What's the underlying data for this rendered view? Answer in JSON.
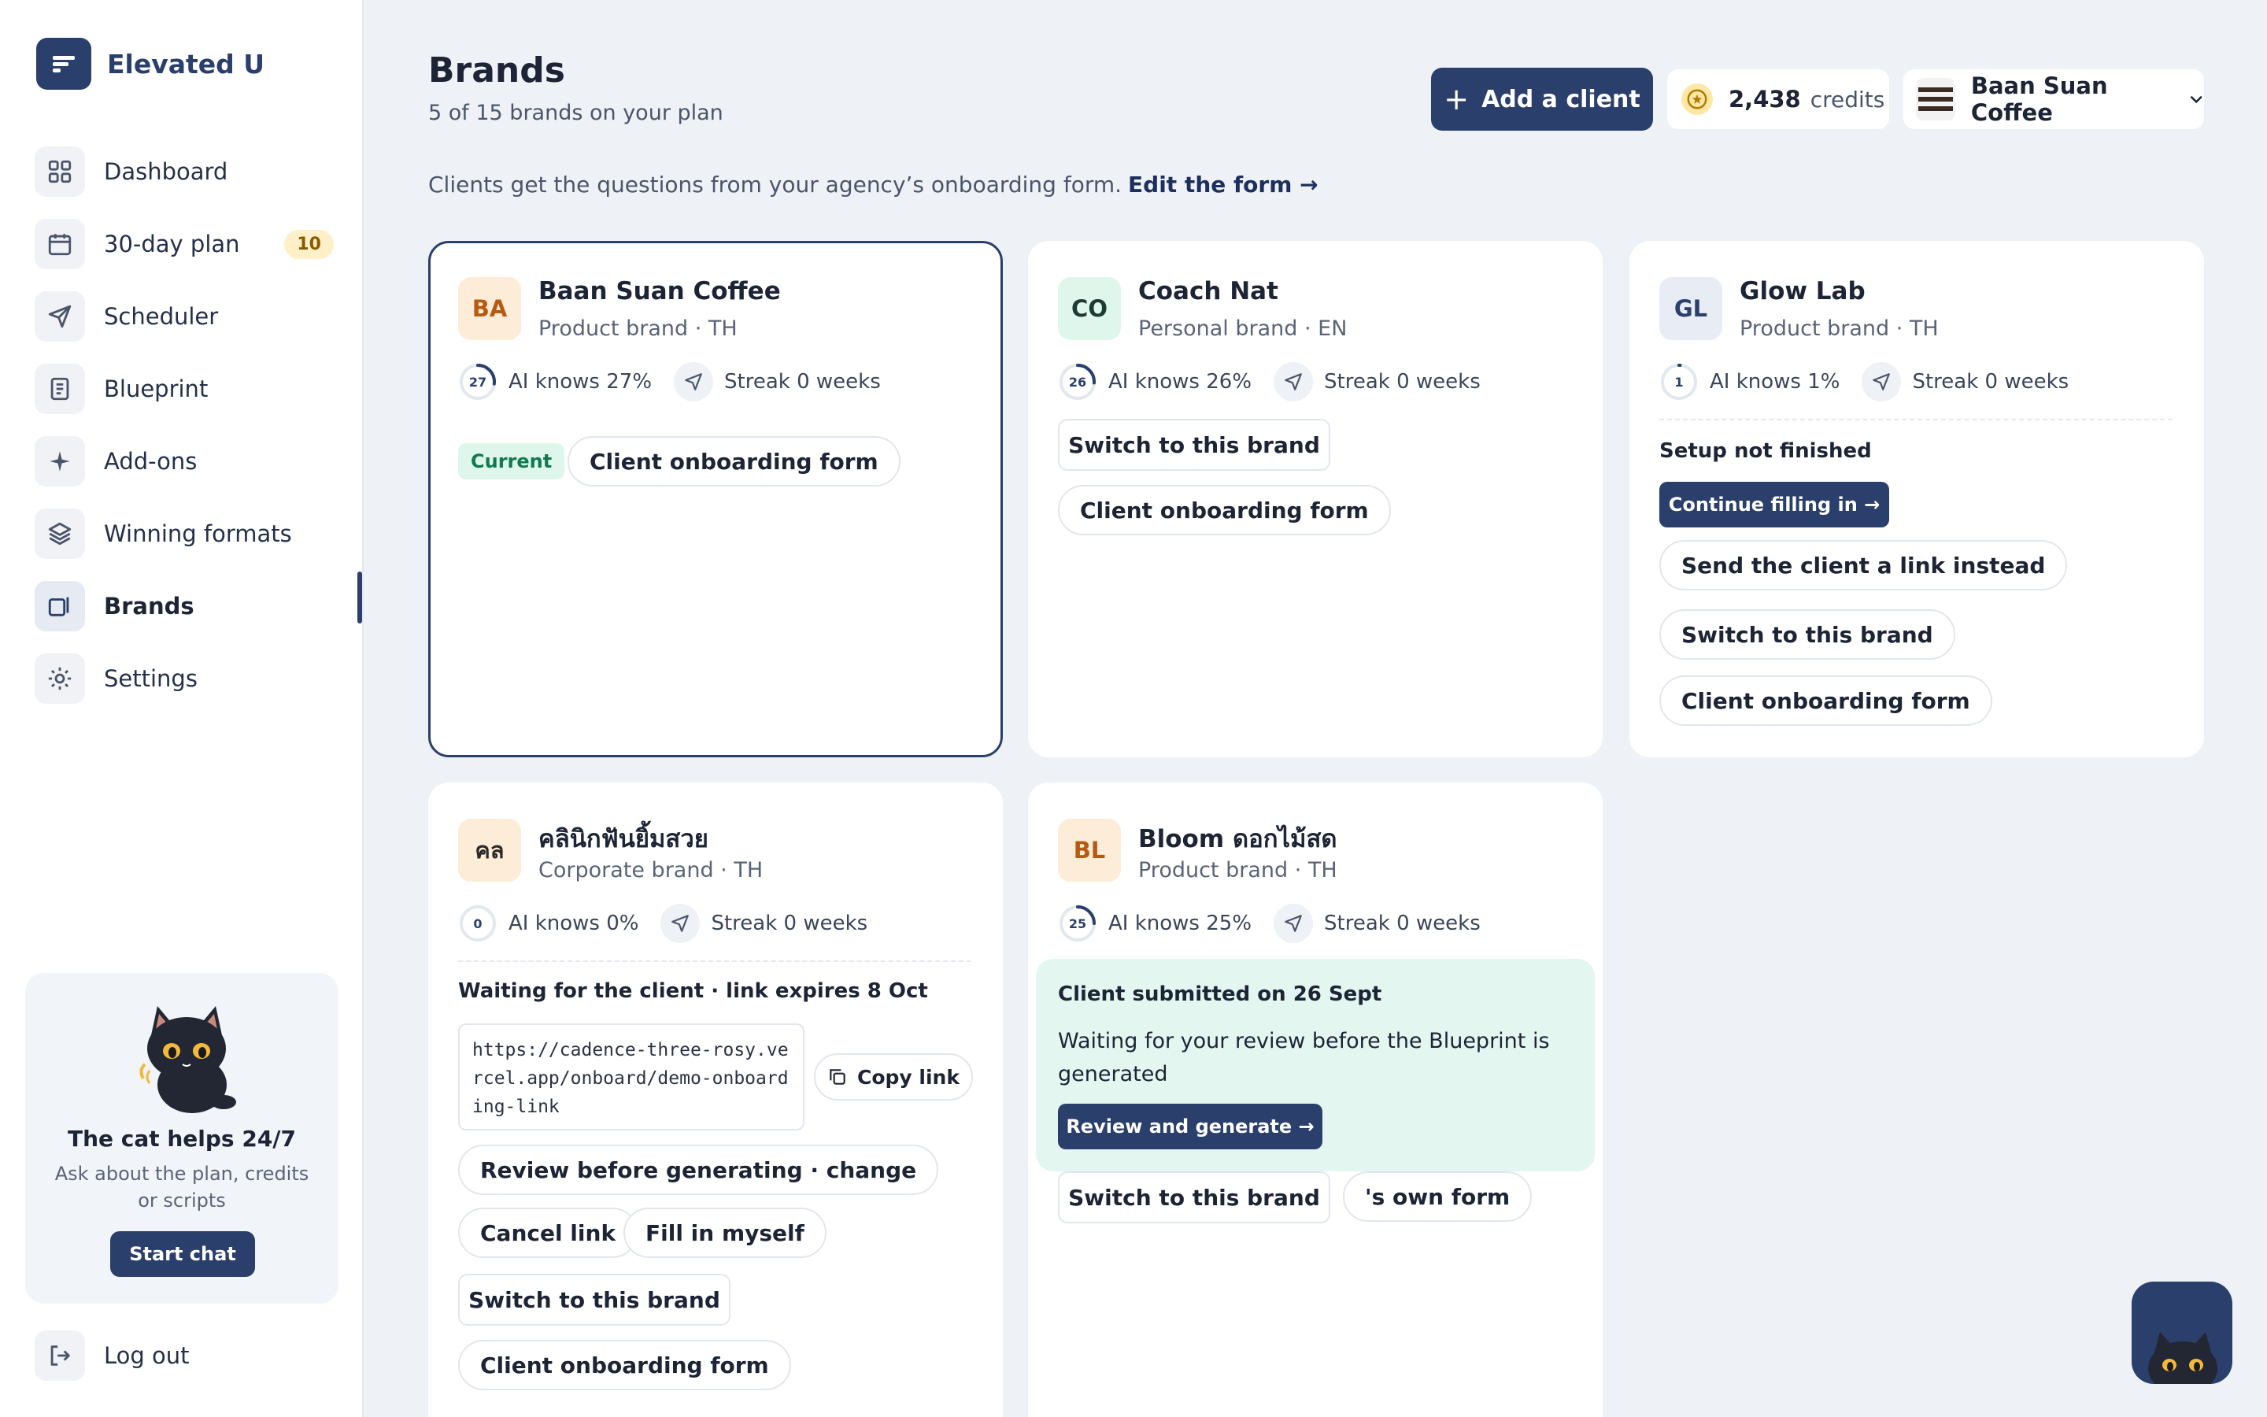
{
  "app": {
    "name": "Elevated U"
  },
  "nav": [
    {
      "label": "Dashboard",
      "icon": "grid-icon"
    },
    {
      "label": "30-day plan",
      "icon": "calendar-icon",
      "badge": "10"
    },
    {
      "label": "Scheduler",
      "icon": "send-icon"
    },
    {
      "label": "Blueprint",
      "icon": "document-icon"
    },
    {
      "label": "Add-ons",
      "icon": "sparkle-icon"
    },
    {
      "label": "Winning formats",
      "icon": "layers-icon"
    },
    {
      "label": "Brands",
      "icon": "brands-icon",
      "active": true
    },
    {
      "label": "Settings",
      "icon": "gear-icon"
    }
  ],
  "help": {
    "title": "The cat helps 24/7",
    "subtitle": "Ask about the plan, credits or scripts",
    "button": "Start chat"
  },
  "logout": "Log out",
  "header": {
    "title": "Brands",
    "subtitle": "5 of 15 brands on your plan",
    "intro": "Clients get the questions from your agency’s onboarding form.",
    "edit_link": "Edit the form →",
    "add_button": "Add a client",
    "credits_value": "2,438",
    "credits_label": "credits",
    "current_brand": "Baan Suan Coffee"
  },
  "cards": {
    "baan": {
      "initials": "BA",
      "name": "Baan Suan Coffee",
      "type": "Product brand · TH",
      "ai_percent": 27,
      "ai_num": "27",
      "ai_text": "AI knows 27%",
      "streak": "Streak 0 weeks",
      "current_tag": "Current",
      "onboarding": "Client onboarding form"
    },
    "coach": {
      "initials": "CO",
      "name": "Coach Nat",
      "type": "Personal brand · EN",
      "ai_percent": 26,
      "ai_num": "26",
      "ai_text": "AI knows 26%",
      "streak": "Streak 0 weeks",
      "switch": "Switch to this brand",
      "onboarding": "Client onboarding form"
    },
    "glow": {
      "initials": "GL",
      "name": "Glow Lab",
      "type": "Product brand · TH",
      "ai_percent": 1,
      "ai_num": "1",
      "ai_text": "AI knows 1%",
      "streak": "Streak 0 weeks",
      "setup": "Setup not finished",
      "continue": "Continue filling in →",
      "send_link": "Send the client a link instead",
      "switch": "Switch to this brand",
      "onboarding": "Client onboarding form"
    },
    "clinic": {
      "initials": "คล",
      "name": "คลินิกฟันยิ้มสวย",
      "type": "Corporate brand · TH",
      "ai_percent": 0,
      "ai_num": "0",
      "ai_text": "AI knows 0%",
      "streak": "Streak 0 weeks",
      "waiting": "Waiting for the client · link expires 8 Oct",
      "url": "https://cadence-three-rosy.vercel.app/onboard/demo-onboarding-link",
      "copy": "Copy link",
      "review_change": "Review before generating · change",
      "cancel": "Cancel link",
      "fill": "Fill in myself",
      "switch": "Switch to this brand",
      "onboarding": "Client onboarding form"
    },
    "bloom": {
      "initials": "BL",
      "name": "Bloom ดอกไม้สด",
      "type": "Product brand · TH",
      "ai_percent": 25,
      "ai_num": "25",
      "ai_text": "AI knows 25%",
      "streak": "Streak 0 weeks",
      "submitted": "Client submitted on 26 Sept",
      "waiting_review": "Waiting for your review before the Blueprint is generated",
      "review_btn": "Review and generate →",
      "switch": "Switch to this brand",
      "own_form": "'s own form"
    }
  },
  "colors": {
    "primary": "#2a3f6b",
    "background": "#eef2f6",
    "success_bg": "#dff6ec",
    "badge_bg": "#fff0c9"
  }
}
